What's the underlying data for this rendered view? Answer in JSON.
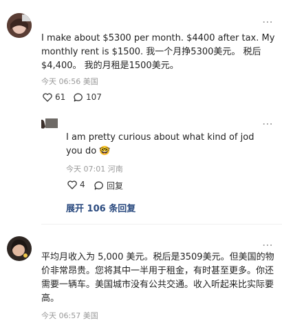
{
  "comments": [
    {
      "text": "I make about $5300 per month. $4400 after tax. My monthly rent is $1500. 我一个月挣5300美元。 税后$4,400。 我的月租是1500美元。",
      "meta": "今天 06:56 美国",
      "likes": "61",
      "replies_count": "107",
      "reply": {
        "text": "I am pretty curious about what kind of jod you do",
        "emoji": "🤓",
        "meta": "今天 07:01 河南",
        "likes": "4",
        "reply_label": "回复"
      },
      "expand_label": "展开 106 条回复"
    },
    {
      "text": "平均月收入为 5,000 美元。税后是3509美元。但美国的物价非常昂贵。您将其中一半用于租金，有时甚至更多。你还需要一辆车。美国城市没有公共交通。收入听起来比实际要高。",
      "meta": "今天 06:57 美国"
    }
  ],
  "icons": {
    "more": "more-dots-icon",
    "like": "heart-icon",
    "comment": "comment-bubble-icon"
  },
  "colors": {
    "meta": "#999999",
    "expand": "#2a4a7f"
  }
}
